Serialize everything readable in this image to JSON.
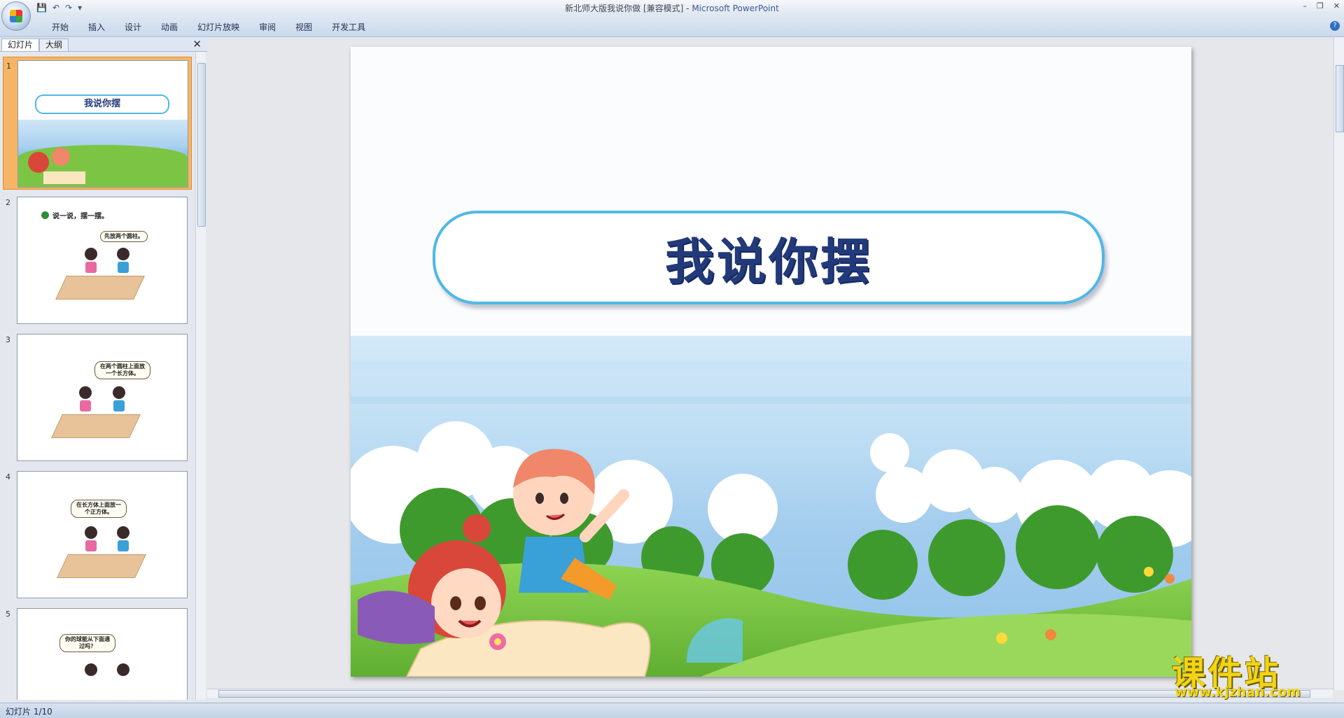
{
  "window": {
    "title": "新北师大版我说你做 [兼容模式] - ",
    "app_name": "Microsoft PowerPoint",
    "controls": [
      "–",
      "❐",
      "✕"
    ]
  },
  "quick_access": [
    "💾",
    "↶",
    "↷",
    "▾"
  ],
  "ribbon": {
    "tabs": [
      "开始",
      "插入",
      "设计",
      "动画",
      "幻灯片放映",
      "审阅",
      "视图",
      "开发工具"
    ],
    "help": "?"
  },
  "panel": {
    "tabs": [
      "幻灯片",
      "大纲"
    ],
    "close": "✕"
  },
  "thumbnails": [
    {
      "num": "1",
      "title": "我说你摆"
    },
    {
      "num": "2",
      "heading": "说一说，摆一摆。",
      "bubble": "先放两个圆柱。"
    },
    {
      "num": "3",
      "bubble": "在两个圆柱上面放一个长方体。"
    },
    {
      "num": "4",
      "bubble": "在长方体上面放一个正方体。"
    },
    {
      "num": "5",
      "bubble": "你的球能从下面通过吗？"
    }
  ],
  "slide": {
    "title": "我说你摆"
  },
  "status": {
    "slide_counter": "幻灯片 1/10"
  },
  "watermark": {
    "main": "课件站",
    "url": "www.kjzhan.com"
  },
  "colors": {
    "title_text": "#233a7a",
    "title_border": "#4fb8e6",
    "sky": "#a8d0ee",
    "grass": "#7cc544",
    "selected_thumb": "#f6b566"
  }
}
